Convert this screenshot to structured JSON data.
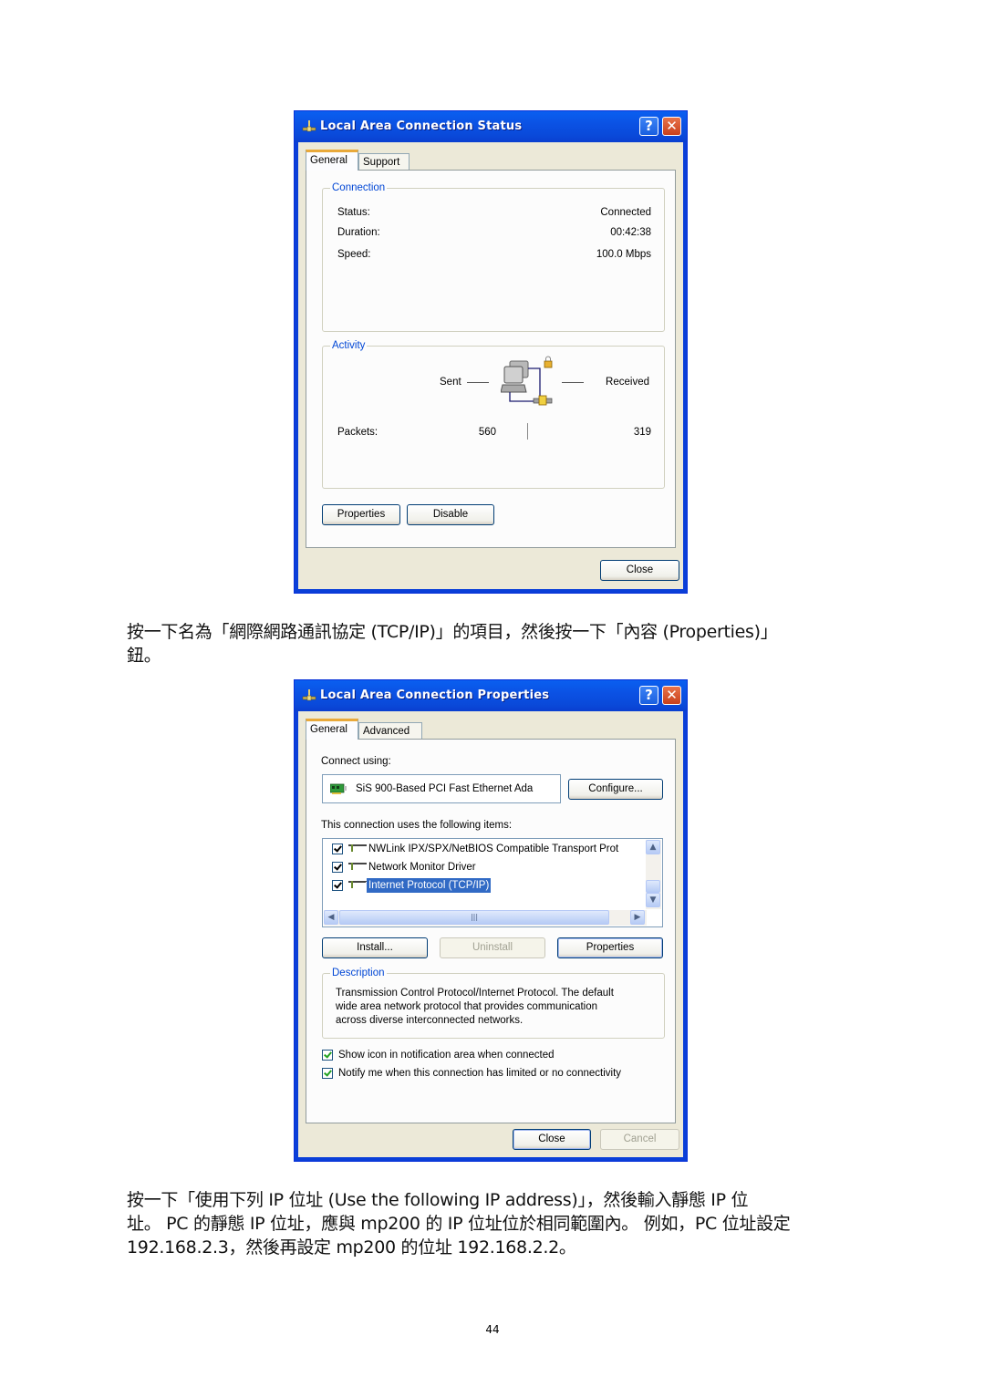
{
  "status_dialog": {
    "title": "Local Area Connection Status",
    "tabs": [
      {
        "label": "General",
        "active": true
      },
      {
        "label": "Support",
        "active": false
      }
    ],
    "connection_group": {
      "legend": "Connection",
      "rows": [
        {
          "label": "Status:",
          "value": "Connected"
        },
        {
          "label": "Duration:",
          "value": "00:42:38"
        },
        {
          "label": "Speed:",
          "value": "100.0 Mbps"
        }
      ]
    },
    "activity_group": {
      "legend": "Activity",
      "sent_label": "Sent",
      "received_label": "Received",
      "packets_label": "Packets:",
      "packets_sent": "560",
      "packets_received": "319"
    },
    "buttons": {
      "properties": "Properties",
      "disable": "Disable",
      "close": "Close"
    },
    "titlebar_buttons": {
      "help": "?",
      "close": "✕"
    }
  },
  "instruction_1": {
    "line1": "按一下名為「網際網路通訊協定 (TCP/IP)」的項目，然後按一下「內容 (Properties)」",
    "line2": "鈕。"
  },
  "properties_dialog": {
    "title": "Local Area Connection Properties",
    "tabs": [
      {
        "label": "General",
        "active": true
      },
      {
        "label": "Advanced",
        "active": false
      }
    ],
    "connect_using_label": "Connect using:",
    "adapter_name": "SiS 900-Based PCI Fast Ethernet Ada",
    "configure_button": "Configure...",
    "items_label": "This connection uses the following items:",
    "items": [
      {
        "label": "NWLink IPX/SPX/NetBIOS Compatible Transport Prot",
        "checked": true,
        "selected": false
      },
      {
        "label": "Network Monitor Driver",
        "checked": true,
        "selected": false
      },
      {
        "label": "Internet Protocol (TCP/IP)",
        "checked": true,
        "selected": true
      }
    ],
    "buttons": {
      "install": "Install...",
      "uninstall": "Uninstall",
      "properties": "Properties",
      "close": "Close",
      "cancel": "Cancel"
    },
    "description_group": {
      "legend": "Description",
      "text_lines": [
        "Transmission Control Protocol/Internet Protocol. The default",
        "wide area network protocol that provides communication",
        "across diverse interconnected networks."
      ]
    },
    "checkboxes": [
      {
        "label": "Show icon in notification area when connected",
        "checked": true
      },
      {
        "label": "Notify me when this connection has limited or no connectivity",
        "checked": true
      }
    ],
    "titlebar_buttons": {
      "help": "?",
      "close": "✕"
    }
  },
  "instruction_2": {
    "line1": "按一下「使用下列 IP 位址 (Use the following IP address)」，然後輸入靜態 IP 位",
    "line2": "址。 PC 的靜態 IP 位址，應與 mp200 的 IP 位址位於相同範圍內。 例如，PC 位址設定",
    "line3": "192.168.2.3，然後再設定 mp200 的位址 192.168.2.2。"
  },
  "page_number": "44"
}
